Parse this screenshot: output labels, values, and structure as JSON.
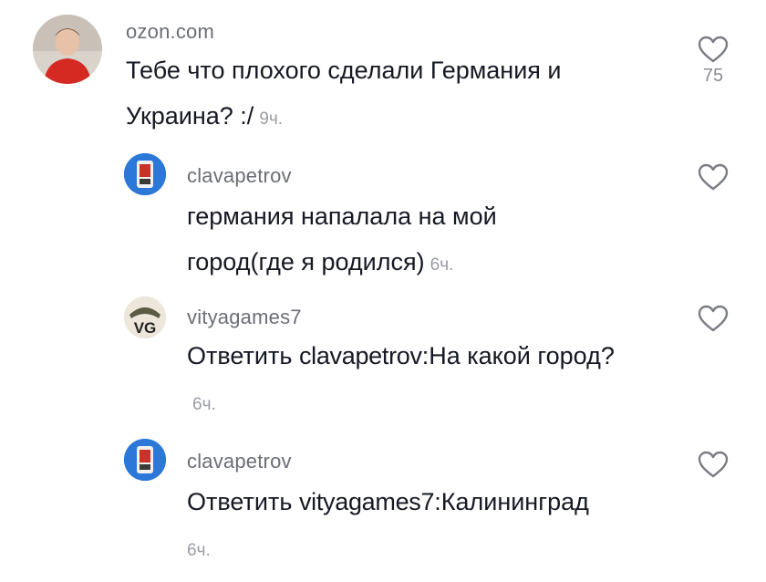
{
  "comments": [
    {
      "username": "ozon.com",
      "text": "Тебе что плохого сделали Германия и Украина? :/",
      "time": "9ч.",
      "likes": "75"
    },
    {
      "username": "clavapetrov",
      "text": "германия напалала на мой город(где я родился)",
      "time": "6ч."
    },
    {
      "username": "vityagames7",
      "reply_prefix": "Ответить",
      "mention": "clavapetrov",
      "text": "На какой город?",
      "time": "6ч.",
      "avatar_text": "VG"
    },
    {
      "username": "clavapetrov",
      "reply_prefix": "Ответить",
      "mention": "vityagames7",
      "text": "Калининград",
      "time": "6ч."
    }
  ],
  "icons": {
    "like": "heart-outline-icon"
  },
  "colors": {
    "text": "#161823",
    "username": "#6b6e76",
    "time": "#9a9ca3",
    "heart": "#7a7c83"
  }
}
